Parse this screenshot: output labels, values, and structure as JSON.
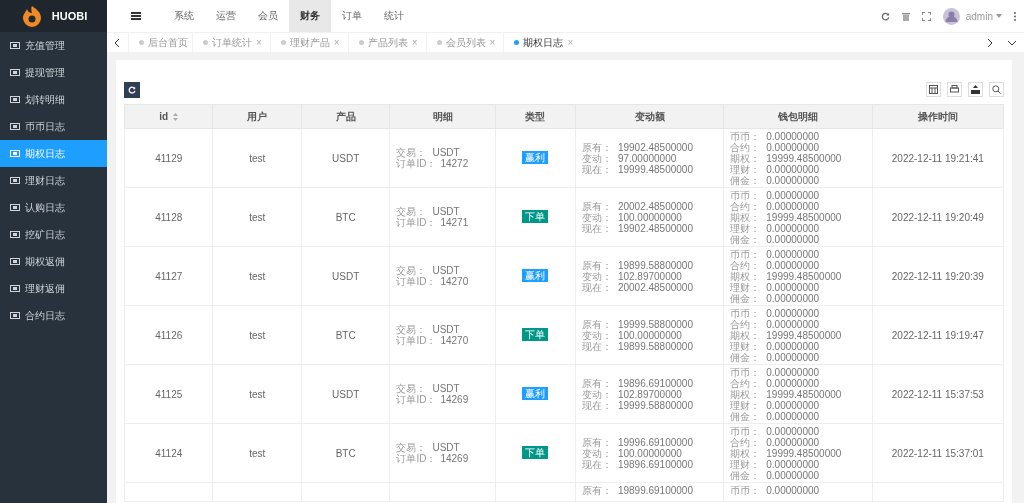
{
  "brand": {
    "name": "HUOBI"
  },
  "topnav": [
    {
      "label": "系统",
      "selected": false
    },
    {
      "label": "运营",
      "selected": false
    },
    {
      "label": "会员",
      "selected": false
    },
    {
      "label": "财务",
      "selected": true
    },
    {
      "label": "订单",
      "selected": false
    },
    {
      "label": "统计",
      "selected": false
    }
  ],
  "user": {
    "name": "admin"
  },
  "sidebar": {
    "items": [
      {
        "label": "充值管理",
        "selected": false
      },
      {
        "label": "提现管理",
        "selected": false
      },
      {
        "label": "划转明细",
        "selected": false
      },
      {
        "label": "币币日志",
        "selected": false
      },
      {
        "label": "期权日志",
        "selected": true
      },
      {
        "label": "理财日志",
        "selected": false
      },
      {
        "label": "认购日志",
        "selected": false
      },
      {
        "label": "挖矿日志",
        "selected": false
      },
      {
        "label": "期权返佣",
        "selected": false
      },
      {
        "label": "理财返佣",
        "selected": false
      },
      {
        "label": "合约日志",
        "selected": false
      }
    ]
  },
  "tabs": [
    {
      "label": "后台首页",
      "selected": false
    },
    {
      "label": "订单统计",
      "selected": false,
      "close": "×"
    },
    {
      "label": "理财产品",
      "selected": false,
      "close": "×"
    },
    {
      "label": "产品列表",
      "selected": false,
      "close": "×"
    },
    {
      "label": "会员列表",
      "selected": false,
      "close": "×"
    },
    {
      "label": "期权日志",
      "selected": true,
      "close": "×"
    }
  ],
  "table": {
    "columns": [
      "id",
      "用户",
      "产品",
      "明细",
      "类型",
      "变动额",
      "钱包明细",
      "操作时间"
    ],
    "rows": [
      {
        "id": "41129",
        "user": "test",
        "product": "USDT",
        "detail": [
          [
            "交易：",
            "USDT"
          ],
          [
            "订单ID：",
            "14272"
          ]
        ],
        "type": {
          "label": "赢利",
          "kind": "win"
        },
        "change": [
          [
            "原有：",
            "19902.48500000"
          ],
          [
            "变动：",
            "97.00000000"
          ],
          [
            "现在：",
            "19999.48500000"
          ]
        ],
        "wallet": [
          [
            "币币：",
            "0.00000000"
          ],
          [
            "合约：",
            "0.00000000"
          ],
          [
            "期权：",
            "19999.48500000"
          ],
          [
            "理财：",
            "0.00000000"
          ],
          [
            "佣金：",
            "0.00000000"
          ]
        ],
        "time": "2022-12-11 19:21:41"
      },
      {
        "id": "41128",
        "user": "test",
        "product": "BTC",
        "detail": [
          [
            "交易：",
            "USDT"
          ],
          [
            "订单ID：",
            "14271"
          ]
        ],
        "type": {
          "label": "下单",
          "kind": "order"
        },
        "change": [
          [
            "原有：",
            "20002.48500000"
          ],
          [
            "变动：",
            "100.00000000"
          ],
          [
            "现在：",
            "19902.48500000"
          ]
        ],
        "wallet": [
          [
            "币币：",
            "0.00000000"
          ],
          [
            "合约：",
            "0.00000000"
          ],
          [
            "期权：",
            "19999.48500000"
          ],
          [
            "理财：",
            "0.00000000"
          ],
          [
            "佣金：",
            "0.00000000"
          ]
        ],
        "time": "2022-12-11 19:20:49"
      },
      {
        "id": "41127",
        "user": "test",
        "product": "USDT",
        "detail": [
          [
            "交易：",
            "USDT"
          ],
          [
            "订单ID：",
            "14270"
          ]
        ],
        "type": {
          "label": "赢利",
          "kind": "win"
        },
        "change": [
          [
            "原有：",
            "19899.58800000"
          ],
          [
            "变动：",
            "102.89700000"
          ],
          [
            "现在：",
            "20002.48500000"
          ]
        ],
        "wallet": [
          [
            "币币：",
            "0.00000000"
          ],
          [
            "合约：",
            "0.00000000"
          ],
          [
            "期权：",
            "19999.48500000"
          ],
          [
            "理财：",
            "0.00000000"
          ],
          [
            "佣金：",
            "0.00000000"
          ]
        ],
        "time": "2022-12-11 19:20:39"
      },
      {
        "id": "41126",
        "user": "test",
        "product": "BTC",
        "detail": [
          [
            "交易：",
            "USDT"
          ],
          [
            "订单ID：",
            "14270"
          ]
        ],
        "type": {
          "label": "下单",
          "kind": "order"
        },
        "change": [
          [
            "原有：",
            "19999.58800000"
          ],
          [
            "变动：",
            "100.00000000"
          ],
          [
            "现在：",
            "19899.58800000"
          ]
        ],
        "wallet": [
          [
            "币币：",
            "0.00000000"
          ],
          [
            "合约：",
            "0.00000000"
          ],
          [
            "期权：",
            "19999.48500000"
          ],
          [
            "理财：",
            "0.00000000"
          ],
          [
            "佣金：",
            "0.00000000"
          ]
        ],
        "time": "2022-12-11 19:19:47"
      },
      {
        "id": "41125",
        "user": "test",
        "product": "USDT",
        "detail": [
          [
            "交易：",
            "USDT"
          ],
          [
            "订单ID：",
            "14269"
          ]
        ],
        "type": {
          "label": "赢利",
          "kind": "win"
        },
        "change": [
          [
            "原有：",
            "19896.69100000"
          ],
          [
            "变动：",
            "102.89700000"
          ],
          [
            "现在：",
            "19999.58800000"
          ]
        ],
        "wallet": [
          [
            "币币：",
            "0.00000000"
          ],
          [
            "合约：",
            "0.00000000"
          ],
          [
            "期权：",
            "19999.48500000"
          ],
          [
            "理财：",
            "0.00000000"
          ],
          [
            "佣金：",
            "0.00000000"
          ]
        ],
        "time": "2022-12-11 15:37:53"
      },
      {
        "id": "41124",
        "user": "test",
        "product": "BTC",
        "detail": [
          [
            "交易：",
            "USDT"
          ],
          [
            "订单ID：",
            "14269"
          ]
        ],
        "type": {
          "label": "下单",
          "kind": "order"
        },
        "change": [
          [
            "原有：",
            "19996.69100000"
          ],
          [
            "变动：",
            "100.00000000"
          ],
          [
            "现在：",
            "19896.69100000"
          ]
        ],
        "wallet": [
          [
            "币币：",
            "0.00000000"
          ],
          [
            "合约：",
            "0.00000000"
          ],
          [
            "期权：",
            "19999.48500000"
          ],
          [
            "理财：",
            "0.00000000"
          ],
          [
            "佣金：",
            "0.00000000"
          ]
        ],
        "time": "2022-12-11 15:37:01"
      },
      {
        "change": [
          [
            "原有：",
            "19899.69100000"
          ]
        ],
        "wallet": [
          [
            "币币：",
            "0.00000000"
          ]
        ]
      }
    ]
  }
}
